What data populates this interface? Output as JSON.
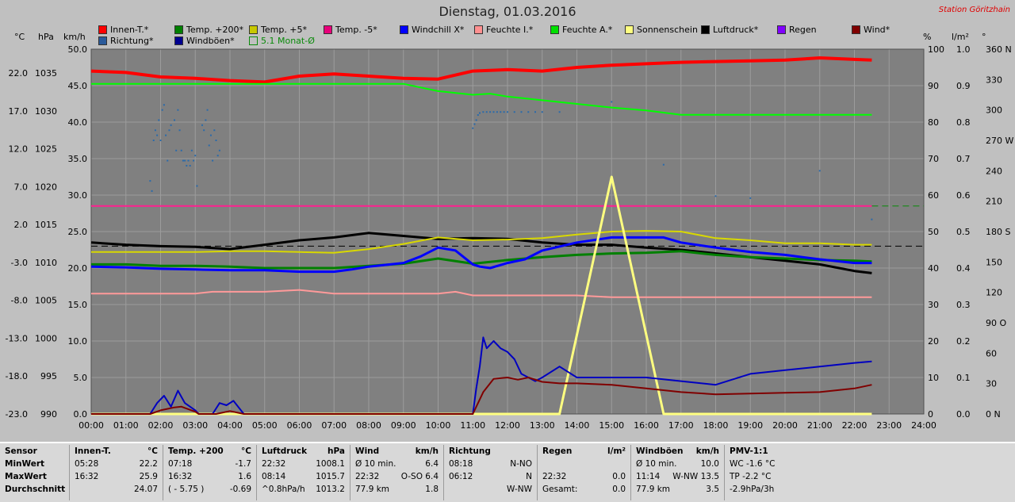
{
  "title": "Dienstag, 01.03.2016",
  "station": "Station Göritzhain",
  "units": {
    "celsius": "°C",
    "hpa": "hPa",
    "kmh": "km/h",
    "percent": "%",
    "lm2": "l/m²",
    "deg": "°"
  },
  "legend": [
    {
      "label": "Innen-T.*",
      "color": "#ff0000"
    },
    {
      "label": "Temp. +200*",
      "color": "#008000"
    },
    {
      "label": "Temp. +5*",
      "color": "#c8c800"
    },
    {
      "label": "Temp. -5*",
      "color": "#e8007a"
    },
    {
      "label": "Windchill X*",
      "color": "#0000ff"
    },
    {
      "label": "Feuchte I.*",
      "color": "#ff9090"
    },
    {
      "label": "Feuchte A.*",
      "color": "#00e000"
    },
    {
      "label": "Sonnenschein",
      "color": "#ffff80"
    },
    {
      "label": "Luftdruck*",
      "color": "#000000"
    },
    {
      "label": "Regen",
      "color": "#8000ff"
    },
    {
      "label": "Wind*",
      "color": "#800000"
    },
    {
      "label": "Richtung*",
      "color": "#2a5a9a"
    },
    {
      "label": "Windböen*",
      "color": "#000090"
    },
    {
      "label": "5.1 Monat-Ø",
      "color": "#0a8a0a"
    }
  ],
  "chart_data": {
    "type": "line",
    "title": "Dienstag, 01.03.2016",
    "x_ticks": [
      "00:00",
      "01:00",
      "02:00",
      "03:00",
      "04:00",
      "05:00",
      "06:00",
      "07:00",
      "08:00",
      "09:00",
      "10:00",
      "11:00",
      "12:00",
      "13:00",
      "14:00",
      "15:00",
      "16:00",
      "17:00",
      "18:00",
      "19:00",
      "20:00",
      "21:00",
      "22:00",
      "23:00",
      "24:00"
    ],
    "axes": {
      "temp_c": {
        "ticks": [
          "22.0",
          "17.0",
          "12.0",
          "7.0",
          "2.0",
          "-3.0",
          "-8.0",
          "-13.0",
          "-18.0",
          "-23.0"
        ],
        "range": [
          -23,
          27
        ]
      },
      "pressure_hpa": {
        "ticks": [
          "1035",
          "1030",
          "1025",
          "1020",
          "1015",
          "1010",
          "1005",
          "1000",
          "995",
          "990"
        ],
        "range": [
          990,
          1040
        ]
      },
      "wind_kmh": {
        "ticks": [
          "50.0",
          "45.0",
          "40.0",
          "35.0",
          "30.0",
          "25.0",
          "20.0",
          "15.0",
          "10.0",
          "5.0",
          "0.0"
        ],
        "range": [
          0,
          50
        ]
      },
      "humidity_pct": {
        "ticks": [
          "100",
          "90",
          "80",
          "70",
          "60",
          "50",
          "40",
          "30",
          "20",
          "10",
          "0"
        ],
        "range": [
          0,
          100
        ]
      },
      "rain_lm2": {
        "ticks": [
          "1.0",
          "0.9",
          "0.8",
          "0.7",
          "0.6",
          "0.5",
          "0.4",
          "0.3",
          "0.2",
          "0.1",
          "0.0"
        ],
        "range": [
          0,
          1
        ]
      },
      "direction_deg": {
        "ticks": [
          "360 N",
          "330",
          "300",
          "270 W",
          "240",
          "210",
          "180 S",
          "150",
          "120",
          "90 O",
          "60",
          "30",
          "0 N"
        ],
        "range": [
          0,
          360
        ]
      }
    },
    "series": [
      {
        "name": "Innen-T.*",
        "axis": "temp_c",
        "color": "#ff0000",
        "width": 4,
        "x": [
          0,
          1,
          2,
          3,
          4,
          5,
          6,
          7,
          8,
          9,
          10,
          11,
          12,
          13,
          14,
          15,
          16,
          17,
          18,
          19,
          20,
          21,
          22,
          22.5
        ],
        "y": [
          24.0,
          23.8,
          23.2,
          23.0,
          22.7,
          22.5,
          23.3,
          23.6,
          23.3,
          23.0,
          22.9,
          24.0,
          24.2,
          24.0,
          24.5,
          24.8,
          25.0,
          25.2,
          25.3,
          25.4,
          25.5,
          25.8,
          25.6,
          25.5
        ]
      },
      {
        "name": "Feuchte A.*",
        "axis": "humidity_pct",
        "color": "#00ff00",
        "width": 2,
        "x": [
          0,
          1,
          2,
          3,
          4,
          5,
          6,
          7,
          8,
          9,
          9.5,
          10,
          11,
          11.5,
          12,
          13,
          14,
          15,
          16,
          17,
          18,
          19,
          20,
          21,
          22,
          22.5
        ],
        "y": [
          90.5,
          90.5,
          90.5,
          90.5,
          90.5,
          90.5,
          90.5,
          90.5,
          90.5,
          90.5,
          89.5,
          88.5,
          87.5,
          87.8,
          87.0,
          86.0,
          85.0,
          84.0,
          83.2,
          82.0,
          82.0,
          82.0,
          82.0,
          82.0,
          82.0,
          82.0
        ]
      },
      {
        "name": "Temp. -5*",
        "axis": "temp_c",
        "color": "#ff1f8f",
        "width": 2,
        "x": [
          0,
          22.5
        ],
        "y": [
          5.5,
          5.5
        ]
      },
      {
        "name": "Luftdruck*",
        "axis": "pressure_hpa",
        "color": "#000000",
        "width": 3,
        "x": [
          0,
          1,
          2,
          3,
          4,
          5,
          6,
          7,
          8,
          9,
          10,
          11,
          12,
          13,
          14,
          15,
          16,
          17,
          18,
          19,
          20,
          21,
          22,
          22.5
        ],
        "y": [
          1013.5,
          1013.2,
          1013.0,
          1012.9,
          1012.6,
          1013.2,
          1013.8,
          1014.2,
          1014.8,
          1014.4,
          1014.0,
          1014.1,
          1014.0,
          1013.5,
          1013.2,
          1013.2,
          1012.8,
          1012.5,
          1012.0,
          1011.5,
          1011.0,
          1010.5,
          1009.6,
          1009.3
        ]
      },
      {
        "name": "Temp. +5*",
        "axis": "temp_c",
        "color": "#d8d800",
        "width": 2,
        "x": [
          0,
          1,
          2,
          3,
          4,
          5,
          6,
          7,
          8,
          9,
          10,
          11,
          12,
          13,
          14,
          15,
          16,
          17,
          18,
          19,
          20,
          21,
          22,
          22.5
        ],
        "y": [
          -0.8,
          -0.8,
          -0.8,
          -0.8,
          -0.7,
          -0.7,
          -0.8,
          -0.9,
          -0.4,
          0.3,
          1.2,
          0.8,
          0.9,
          1.1,
          1.6,
          2.0,
          2.1,
          2.0,
          1.1,
          0.8,
          0.4,
          0.4,
          0.2,
          0.2
        ]
      },
      {
        "name": "Temp. +200*",
        "axis": "temp_c",
        "color": "#008000",
        "width": 3,
        "x": [
          0,
          1,
          2,
          3,
          4,
          5,
          6,
          7,
          8,
          9,
          10,
          11,
          12,
          13,
          14,
          15,
          16,
          17,
          18,
          19,
          20,
          21,
          22,
          22.5
        ],
        "y": [
          -2.5,
          -2.5,
          -2.7,
          -2.7,
          -2.8,
          -3.0,
          -3.0,
          -3.0,
          -2.7,
          -2.4,
          -1.7,
          -2.4,
          -1.9,
          -1.5,
          -1.2,
          -1.0,
          -0.9,
          -0.7,
          -1.2,
          -1.5,
          -1.7,
          -1.9,
          -2.0,
          -2.1
        ]
      },
      {
        "name": "Windchill X*",
        "axis": "temp_c",
        "color": "#0000ff",
        "width": 3,
        "x": [
          0,
          1,
          2,
          3,
          4,
          5,
          6,
          7,
          7.5,
          8,
          9,
          9.5,
          10,
          10.5,
          11,
          11.2,
          11.5,
          12,
          12.5,
          13,
          14,
          15,
          16,
          16.5,
          17,
          18,
          19,
          20,
          21,
          22,
          22.5
        ],
        "y": [
          -2.8,
          -2.9,
          -3.1,
          -3.2,
          -3.3,
          -3.3,
          -3.5,
          -3.5,
          -3.2,
          -2.8,
          -2.3,
          -1.4,
          -0.2,
          -0.6,
          -2.5,
          -2.8,
          -3.0,
          -2.3,
          -1.8,
          -0.6,
          0.5,
          1.2,
          1.2,
          1.2,
          0.5,
          -0.2,
          -0.8,
          -1.2,
          -1.8,
          -2.3,
          -2.3
        ]
      },
      {
        "name": "Feuchte I.*",
        "axis": "humidity_pct",
        "color": "#ff9a9a",
        "width": 2,
        "x": [
          0,
          1,
          2,
          3,
          3.5,
          4,
          5,
          6,
          6.5,
          7,
          8,
          9,
          10,
          10.5,
          11,
          12,
          13,
          14,
          15,
          16,
          17,
          18,
          19,
          20,
          21,
          22,
          22.5
        ],
        "y": [
          33.0,
          33.0,
          33.0,
          33.0,
          33.5,
          33.5,
          33.5,
          34.0,
          33.5,
          33.0,
          33.0,
          33.0,
          33.0,
          33.5,
          32.5,
          32.5,
          32.5,
          32.5,
          32.0,
          32.0,
          32.0,
          32.0,
          32.0,
          32.0,
          32.0,
          32.0,
          32.0
        ]
      },
      {
        "name": "Sonnenschein",
        "axis": "humidity_pct",
        "color": "#ffff80",
        "width": 3,
        "x": [
          0,
          13.5,
          15.0,
          16.5,
          22.5
        ],
        "y": [
          0,
          0,
          65,
          0,
          0
        ]
      },
      {
        "name": "Windböen*",
        "axis": "wind_kmh",
        "color": "#0000c0",
        "width": 2,
        "x": [
          0,
          1.7,
          1.9,
          2.1,
          2.3,
          2.5,
          2.7,
          3.0,
          3.1,
          3.5,
          3.7,
          3.9,
          4.1,
          4.4,
          11.0,
          11.1,
          11.2,
          11.3,
          11.4,
          11.6,
          11.8,
          12.0,
          12.2,
          12.4,
          12.6,
          12.8,
          13.0,
          13.5,
          14.0,
          15.0,
          16.0,
          17.0,
          18.0,
          19.0,
          20.0,
          21.0,
          22.0,
          22.5
        ],
        "y": [
          0,
          0,
          1.5,
          2.5,
          1.0,
          3.2,
          1.5,
          0.5,
          0,
          0,
          1.5,
          1.2,
          1.8,
          0,
          0,
          3.5,
          6.5,
          10.5,
          9.0,
          10.0,
          9.0,
          8.5,
          7.5,
          5.5,
          5.0,
          4.5,
          5.0,
          6.5,
          5.0,
          5.0,
          5.0,
          4.5,
          4.0,
          5.5,
          6.0,
          6.5,
          7.0,
          7.2
        ]
      },
      {
        "name": "Wind*",
        "axis": "wind_kmh",
        "color": "#800000",
        "width": 2,
        "x": [
          0,
          1.7,
          2.0,
          2.4,
          2.6,
          3.0,
          3.1,
          3.6,
          4.0,
          4.4,
          11.0,
          11.3,
          11.6,
          12.0,
          12.3,
          12.6,
          13.0,
          13.5,
          14.0,
          15.0,
          16.0,
          17.0,
          18.0,
          19.0,
          20.0,
          21.0,
          22.0,
          22.5
        ],
        "y": [
          0,
          0,
          0.5,
          0.9,
          1.0,
          0.3,
          0,
          0,
          0.4,
          0,
          0,
          3.0,
          4.8,
          5.0,
          4.7,
          5.0,
          4.4,
          4.2,
          4.2,
          4.0,
          3.5,
          3.0,
          2.7,
          2.8,
          2.9,
          3.0,
          3.5,
          4.0
        ]
      }
    ],
    "dashed_lines": [
      {
        "name": "5.1 Monat-Ø",
        "axis": "temp_c",
        "color": "#0a8a0a",
        "y": 5.5,
        "x": [
          22.5,
          24.0
        ]
      },
      {
        "name": "Luftdruck-Ø",
        "axis": "temp_c",
        "color": "#000000",
        "y": 0.0,
        "x": [
          0,
          24.0
        ]
      }
    ],
    "direction_points": {
      "axis": "direction_deg",
      "color": "#2a6aaa",
      "x": [
        1.7,
        1.75,
        1.8,
        1.85,
        1.9,
        1.95,
        2.0,
        2.05,
        2.1,
        2.15,
        2.2,
        2.25,
        2.3,
        2.4,
        2.45,
        2.5,
        2.55,
        2.6,
        2.65,
        2.7,
        2.75,
        2.8,
        2.85,
        2.9,
        2.95,
        3.0,
        3.05,
        3.2,
        3.25,
        3.3,
        3.35,
        3.4,
        3.45,
        3.5,
        3.55,
        3.6,
        3.65,
        3.7,
        11.0,
        11.05,
        11.1,
        11.15,
        11.2,
        11.3,
        11.4,
        11.5,
        11.6,
        11.7,
        11.8,
        11.9,
        12.0,
        12.2,
        12.4,
        12.6,
        12.8,
        13.0,
        13.5,
        15.0,
        16.5,
        18.0,
        19.0,
        21.0,
        22.5
      ],
      "y": [
        230,
        220,
        270,
        280,
        275,
        290,
        270,
        300,
        305,
        275,
        250,
        280,
        285,
        290,
        260,
        300,
        280,
        260,
        250,
        250,
        245,
        250,
        245,
        260,
        250,
        255,
        225,
        285,
        280,
        290,
        300,
        265,
        275,
        250,
        280,
        270,
        255,
        260,
        282,
        286,
        290,
        295,
        297,
        298,
        298,
        298,
        298,
        298,
        298,
        298,
        298,
        298,
        298,
        298,
        298,
        298,
        298,
        308,
        246,
        215,
        213,
        240,
        192
      ]
    }
  },
  "stats": {
    "sensor": {
      "header": "Sensor",
      "min": "MinWert",
      "max": "MaxWert",
      "avg": "Durchschnitt"
    },
    "innen": {
      "header": "Innen-T.",
      "unit": "°C",
      "min_time": "05:28",
      "min_val": "22.2",
      "max_time": "16:32",
      "max_val": "25.9",
      "avg_val": "24.07"
    },
    "temp200": {
      "header": "Temp. +200",
      "unit": "°C",
      "min_time": "07:18",
      "min_val": "-1.7",
      "max_time": "16:32",
      "max_val": "1.6",
      "avg_time": "( - 5.75 )",
      "avg_val": "-0.69"
    },
    "luftdruck": {
      "header": "Luftdruck",
      "unit": "hPa",
      "min_time": "22:32",
      "min_val": "1008.1",
      "max_time": "08:14",
      "max_val": "1015.7",
      "avg_time": "^0.8hPa/h",
      "avg_val": "1013.2"
    },
    "wind": {
      "header": "Wind",
      "unit": "km/h",
      "min_time": "Ø 10 min.",
      "min_val": "6.4",
      "max_time": "22:32",
      "max_val": "O-SO 6.4",
      "avg_time": "77.9 km",
      "avg_val": "1.8"
    },
    "richtung": {
      "header": "Richtung",
      "min_time": "08:18",
      "min_val": "N-NO",
      "max_time": "06:12",
      "max_val": "N",
      "avg_val": "W-NW"
    },
    "regen": {
      "header": "Regen",
      "unit": "l/m²",
      "max_time": "22:32",
      "max_val": "0.0",
      "avg_time": "Gesamt:",
      "avg_val": "0.0"
    },
    "windboen": {
      "header": "Windböen",
      "unit": "km/h",
      "min_time": "Ø 10 min.",
      "min_val": "10.0",
      "max_time": "11:14",
      "max_val": "W-NW 13.5",
      "avg_time": "77.9 km",
      "avg_val": "3.5"
    },
    "pmv": {
      "header": "PMV-1:1",
      "min_val": "WC -1.6 °C",
      "max_val": "TP -2.2 °C",
      "avg_val": "-2.9hPa/3h"
    }
  }
}
